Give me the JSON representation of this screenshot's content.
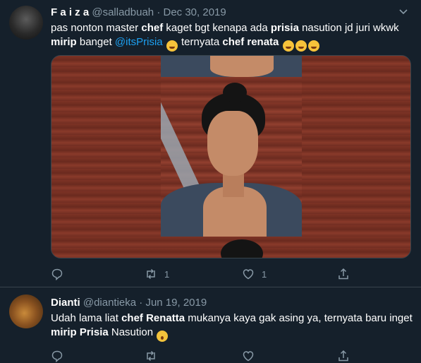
{
  "tweet1": {
    "name": "F a i z a",
    "handle": "@salladbuah",
    "sep": "·",
    "date": "Dec 30, 2019",
    "text": [
      {
        "t": "pas nonton master ",
        "style": "plain"
      },
      {
        "t": "chef",
        "style": "bold"
      },
      {
        "t": " kaget bgt kenapa ada ",
        "style": "plain"
      },
      {
        "t": "prisia",
        "style": "bold"
      },
      {
        "t": " nasution jd juri wkwk ",
        "style": "plain"
      },
      {
        "t": "mirip",
        "style": "bold"
      },
      {
        "t": " banget ",
        "style": "plain"
      },
      {
        "t": "@itsPrisia",
        "style": "mention"
      },
      {
        "t": " ",
        "style": "plain"
      },
      {
        "t": "😂",
        "style": "emoji"
      },
      {
        "t": " ternyata ",
        "style": "plain"
      },
      {
        "t": "chef renata",
        "style": "bold"
      },
      {
        "t": " ",
        "style": "plain"
      },
      {
        "t": "😂",
        "style": "emoji"
      },
      {
        "t": "😂",
        "style": "emoji"
      },
      {
        "t": "😂",
        "style": "emoji"
      }
    ],
    "retweets": "1",
    "likes": "1",
    "icons": [
      "reply-icon",
      "retweet-icon",
      "like-icon",
      "share-icon",
      "chevron-down-icon"
    ]
  },
  "tweet2": {
    "name": "Dianti",
    "handle": "@diantieka",
    "sep": "·",
    "date": "Jun 19, 2019",
    "text": [
      {
        "t": "Udah lama liat ",
        "style": "plain"
      },
      {
        "t": "chef Renatta",
        "style": "bold"
      },
      {
        "t": " mukanya kaya gak asing ya, ternyata baru inget ",
        "style": "plain"
      },
      {
        "t": "mirip Prisia",
        "style": "bold"
      },
      {
        "t": " Nasution ",
        "style": "plain"
      },
      {
        "t": "😱",
        "style": "emoji-scream"
      }
    ]
  },
  "colors": {
    "background": "#15202b",
    "muted": "#8899a6",
    "link": "#1da1f2",
    "divider": "#38444d"
  }
}
